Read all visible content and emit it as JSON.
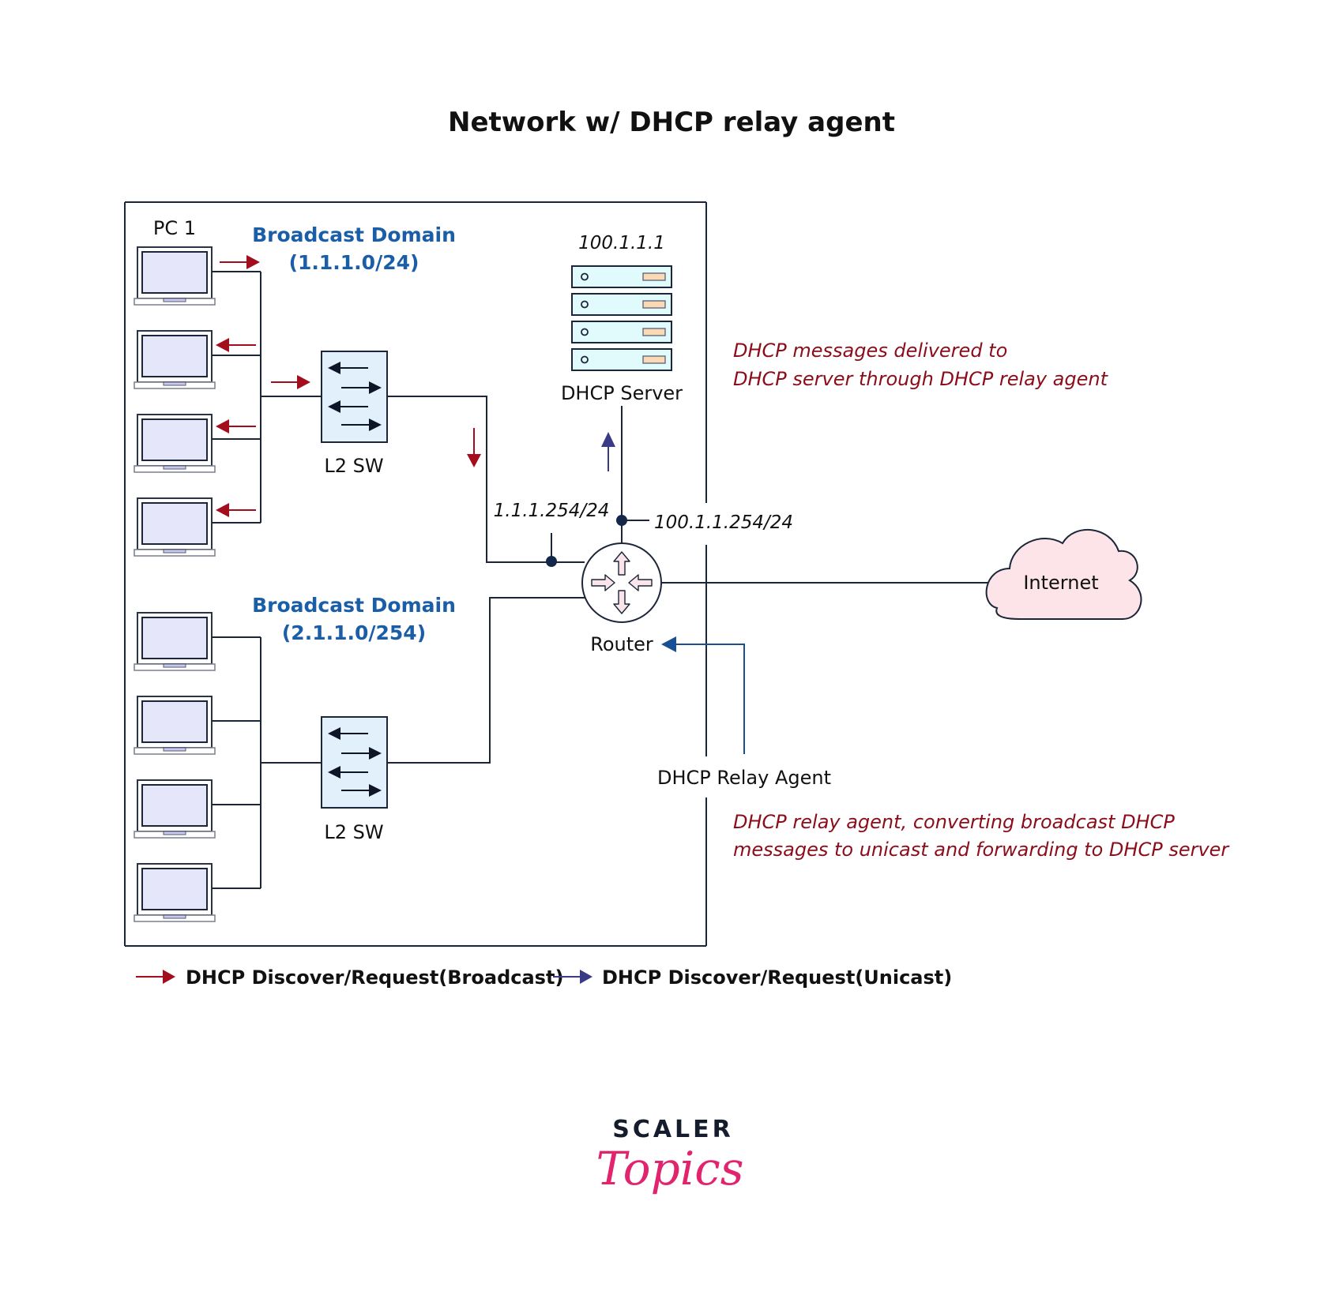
{
  "title": "Network w/ DHCP relay agent",
  "colors": {
    "broadcast_arrow": "#a30d1c",
    "unicast_arrow": "#3a3a86",
    "relay_arrow": "#1a4f94",
    "domain_text": "#1a5ea8",
    "note_text": "#8b0d1a",
    "cloud_fill": "#fde4e8",
    "server_fill": "#e1fbfd",
    "switch_fill": "#e2f0fb",
    "laptop_screen": "#e6e6fb",
    "logo_pink": "#e0246e",
    "logo_dark": "#151c2c"
  },
  "labels": {
    "pc1": "PC 1",
    "domain1_title": "Broadcast Domain",
    "domain1_subnet": "(1.1.1.0/24)",
    "domain2_title": "Broadcast Domain",
    "domain2_subnet": "(2.1.1.0/254)",
    "switch1": "L2 SW",
    "switch2": "L2 SW",
    "server_ip": "100.1.1.1",
    "server": "DHCP Server",
    "router_if1": "1.1.1.254/24",
    "router_if2": "100.1.1.254/24",
    "router": "Router",
    "internet": "Internet",
    "relay_agent": "DHCP Relay Agent"
  },
  "notes": {
    "delivered_line1": "DHCP messages delivered to",
    "delivered_line2": "DHCP server through DHCP relay agent",
    "relay_line1": "DHCP relay agent, converting broadcast DHCP",
    "relay_line2": "messages to unicast and forwarding to DHCP server"
  },
  "legend": [
    {
      "label": "DHCP Discover/Request(Broadcast)",
      "icon": "red-arrow-icon"
    },
    {
      "label": "DHCP Discover/Request(Unicast)",
      "icon": "blue-arrow-icon"
    }
  ],
  "domains": [
    {
      "name": "Broadcast Domain",
      "subnet": "1.1.1.0/24",
      "pc_count": 4,
      "broadcast_arrows": [
        "out",
        "in",
        "in",
        "in"
      ]
    },
    {
      "name": "Broadcast Domain",
      "subnet": "2.1.1.0/254",
      "pc_count": 4
    }
  ],
  "logo": {
    "line1": "SCALER",
    "line2": "Topics"
  }
}
